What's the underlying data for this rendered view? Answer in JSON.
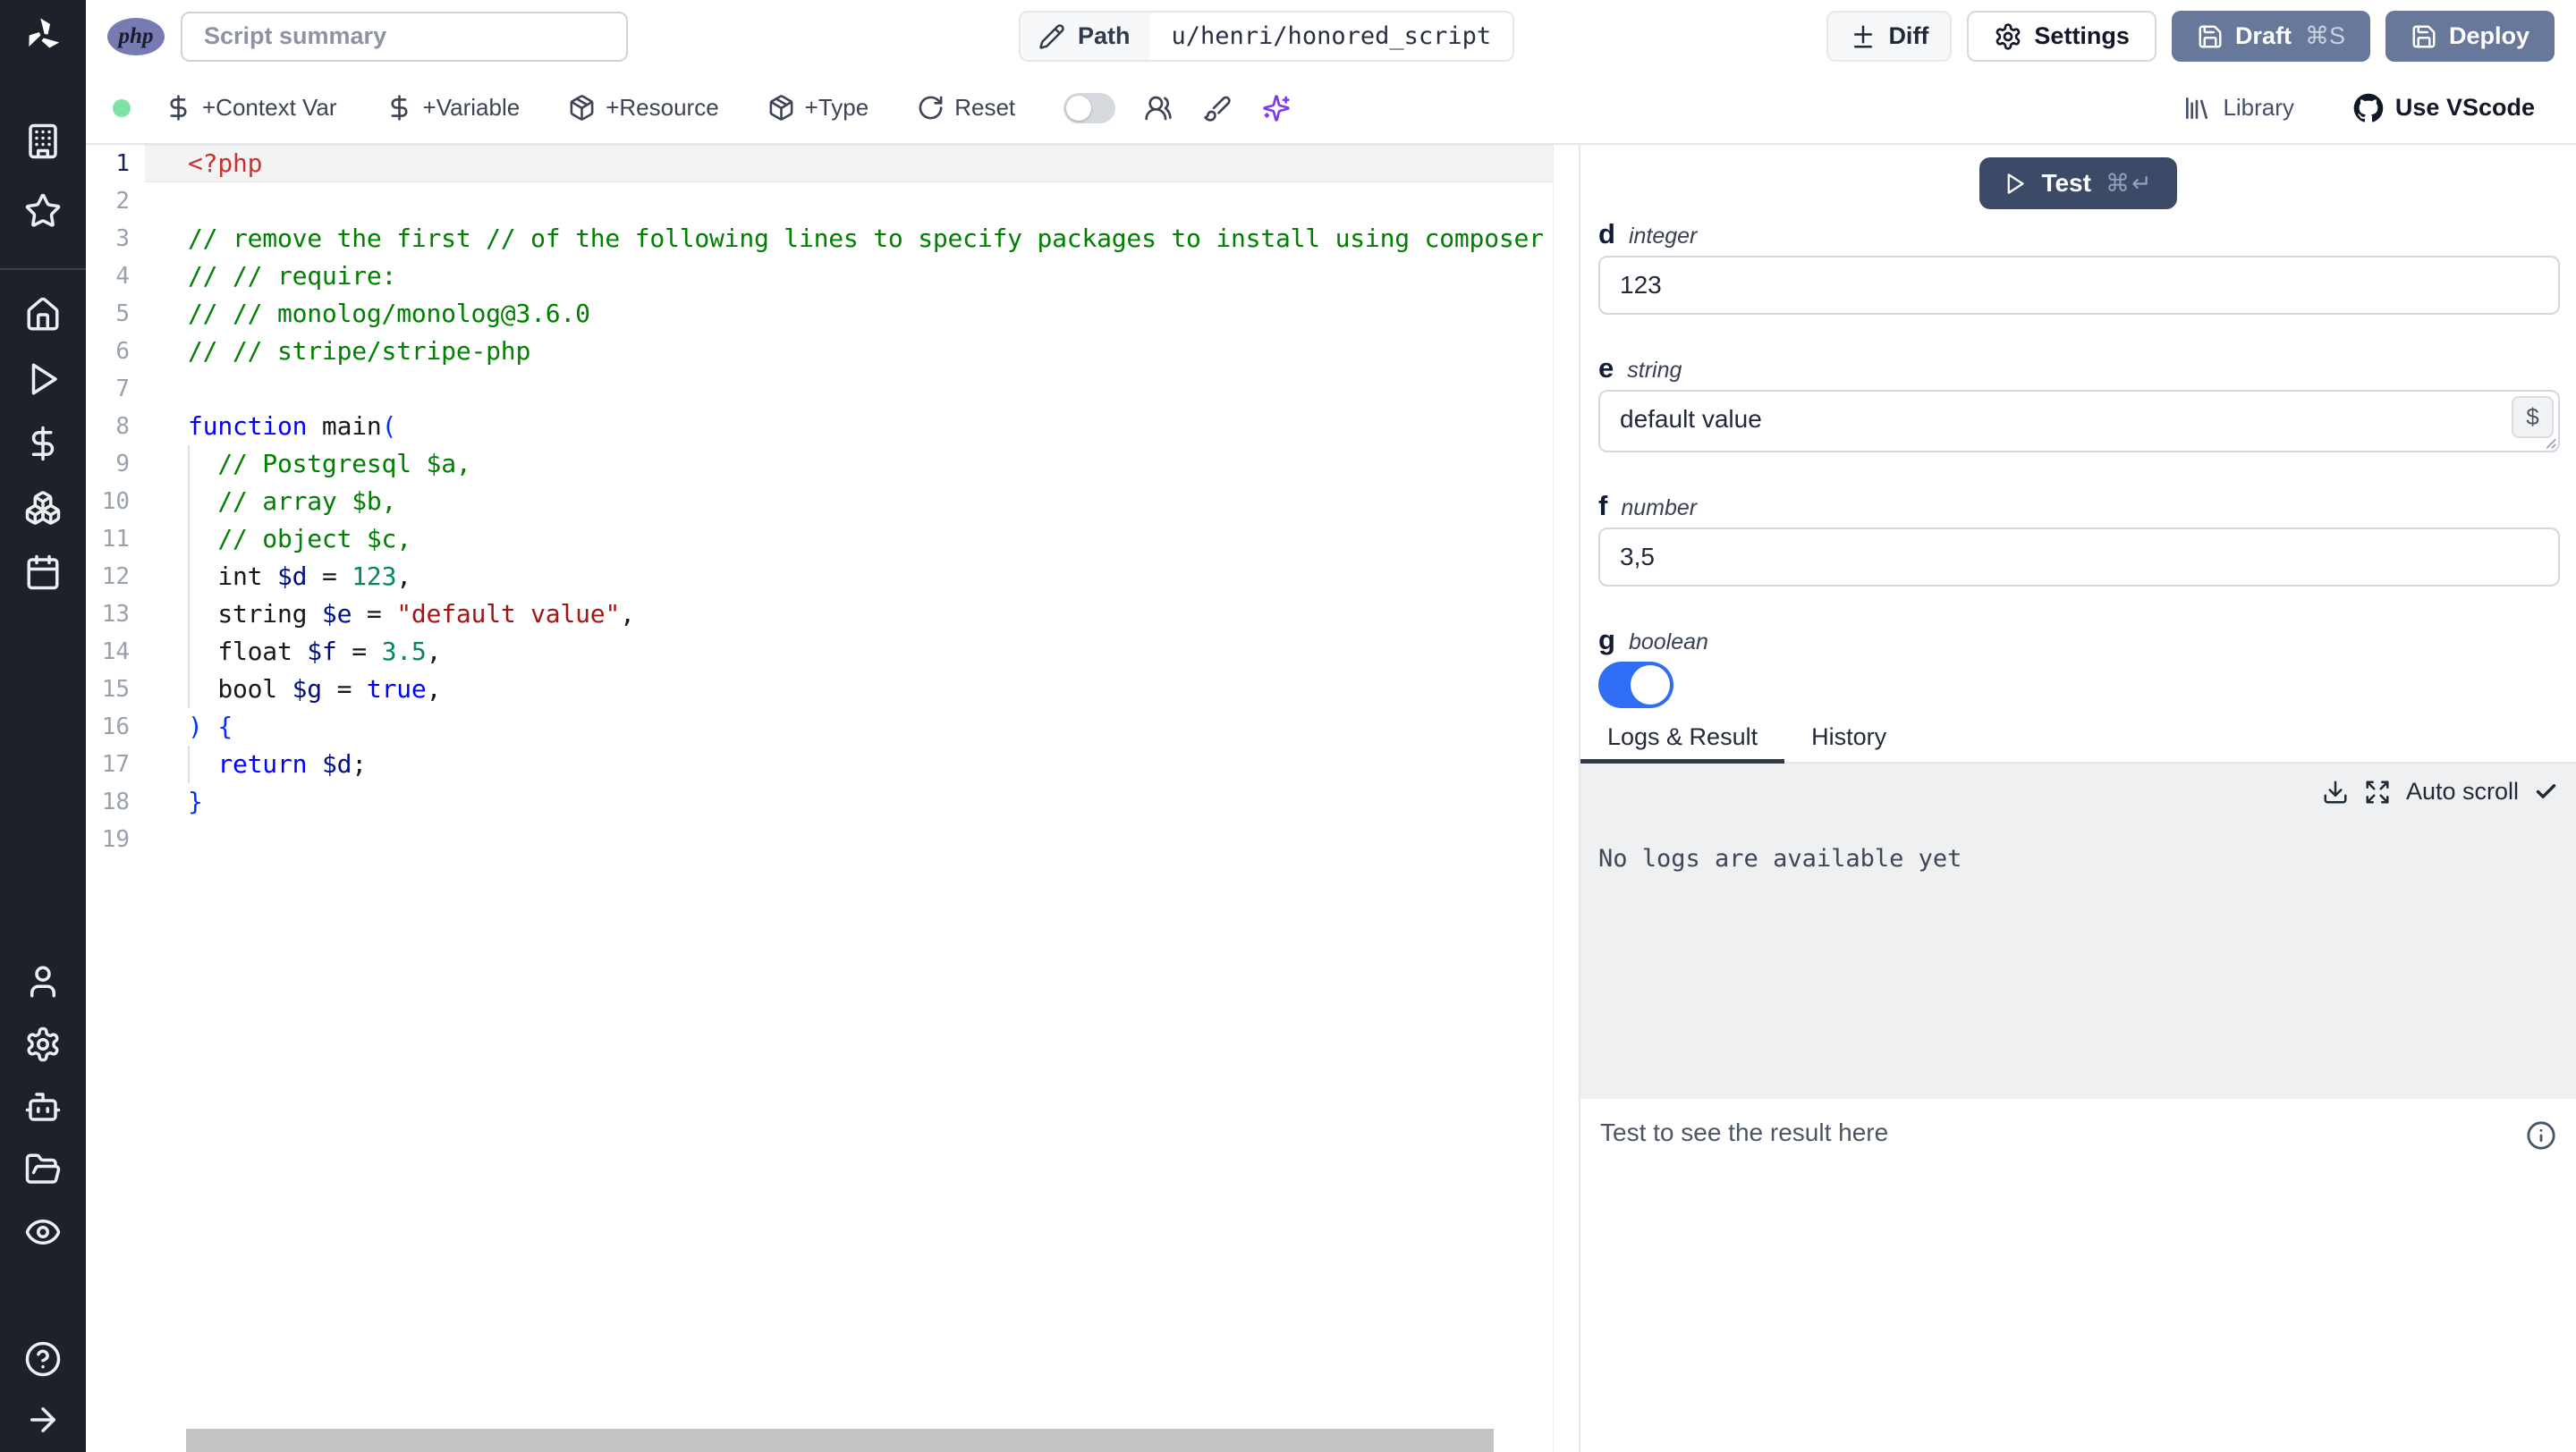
{
  "topbar": {
    "language_badge": "php",
    "summary_placeholder": "Script summary",
    "path": {
      "label": "Path",
      "value": "u/henri/honored_script"
    },
    "buttons": {
      "diff": "Diff",
      "settings": "Settings",
      "draft": "Draft",
      "draft_shortcut": "⌘S",
      "deploy": "Deploy"
    }
  },
  "toolbar": {
    "status_dot_color": "#7fe3a8",
    "items": [
      {
        "icon": "dollar-icon",
        "label": "+Context Var"
      },
      {
        "icon": "dollar-icon",
        "label": "+Variable"
      },
      {
        "icon": "package-icon",
        "label": "+Resource"
      },
      {
        "icon": "package-icon",
        "label": "+Type"
      },
      {
        "icon": "reset-icon",
        "label": "Reset"
      }
    ],
    "diff_mode_toggle_on": false,
    "icon_buttons": [
      "users-icon",
      "paintbrush-icon",
      "sparkles-icon"
    ],
    "right": [
      {
        "icon": "library-icon",
        "label": "Library",
        "strong": false
      },
      {
        "icon": "github-icon",
        "label": "Use VScode",
        "strong": true
      }
    ]
  },
  "sidebar": {
    "groups": {
      "top": [
        "building-icon",
        "star-icon"
      ],
      "main": [
        "home-icon",
        "play-icon",
        "dollar-icon",
        "boxes-icon",
        "calendar-icon"
      ],
      "account": [
        "user-icon",
        "gear-icon",
        "bot-icon",
        "folder-open-icon",
        "eye-icon"
      ],
      "footer": [
        "help-icon",
        "arrow-right-icon"
      ]
    }
  },
  "editor": {
    "language": "php",
    "current_line": 1,
    "lines": [
      {
        "n": 1,
        "guide": false,
        "tokens": [
          [
            "php-tag",
            "<?php"
          ]
        ]
      },
      {
        "n": 2,
        "guide": false,
        "tokens": []
      },
      {
        "n": 3,
        "guide": false,
        "tokens": [
          [
            "comment",
            "// remove the first // of the following lines to specify packages to install using composer"
          ]
        ]
      },
      {
        "n": 4,
        "guide": false,
        "tokens": [
          [
            "comment",
            "// // require:"
          ]
        ]
      },
      {
        "n": 5,
        "guide": false,
        "tokens": [
          [
            "comment",
            "// // monolog/monolog@3.6.0"
          ]
        ]
      },
      {
        "n": 6,
        "guide": false,
        "tokens": [
          [
            "comment",
            "// // stripe/stripe-php"
          ]
        ]
      },
      {
        "n": 7,
        "guide": false,
        "tokens": []
      },
      {
        "n": 8,
        "guide": false,
        "tokens": [
          [
            "keyword",
            "function"
          ],
          [
            "plain",
            " main"
          ],
          [
            "bracket",
            "("
          ]
        ]
      },
      {
        "n": 9,
        "guide": true,
        "tokens": [
          [
            "plain",
            "  "
          ],
          [
            "comment",
            "// Postgresql $a,"
          ]
        ]
      },
      {
        "n": 10,
        "guide": true,
        "tokens": [
          [
            "plain",
            "  "
          ],
          [
            "comment",
            "// array $b,"
          ]
        ]
      },
      {
        "n": 11,
        "guide": true,
        "tokens": [
          [
            "plain",
            "  "
          ],
          [
            "comment",
            "// object $c,"
          ]
        ]
      },
      {
        "n": 12,
        "guide": true,
        "tokens": [
          [
            "plain",
            "  int "
          ],
          [
            "variable",
            "$d"
          ],
          [
            "plain",
            " = "
          ],
          [
            "number",
            "123"
          ],
          [
            "plain",
            ","
          ]
        ]
      },
      {
        "n": 13,
        "guide": true,
        "tokens": [
          [
            "plain",
            "  string "
          ],
          [
            "variable",
            "$e"
          ],
          [
            "plain",
            " = "
          ],
          [
            "string",
            "\"default value\""
          ],
          [
            "plain",
            ","
          ]
        ]
      },
      {
        "n": 14,
        "guide": true,
        "tokens": [
          [
            "plain",
            "  float "
          ],
          [
            "variable",
            "$f"
          ],
          [
            "plain",
            " = "
          ],
          [
            "number",
            "3.5"
          ],
          [
            "plain",
            ","
          ]
        ]
      },
      {
        "n": 15,
        "guide": true,
        "tokens": [
          [
            "plain",
            "  bool "
          ],
          [
            "variable",
            "$g"
          ],
          [
            "plain",
            " = "
          ],
          [
            "keyword",
            "true"
          ],
          [
            "plain",
            ","
          ]
        ]
      },
      {
        "n": 16,
        "guide": false,
        "tokens": [
          [
            "bracket",
            ") {"
          ]
        ]
      },
      {
        "n": 17,
        "guide": true,
        "tokens": [
          [
            "plain",
            "  "
          ],
          [
            "keyword",
            "return"
          ],
          [
            "plain",
            " "
          ],
          [
            "variable",
            "$d"
          ],
          [
            "plain",
            ";"
          ]
        ]
      },
      {
        "n": 18,
        "guide": false,
        "tokens": [
          [
            "bracket",
            "}"
          ]
        ]
      },
      {
        "n": 19,
        "guide": false,
        "tokens": []
      }
    ]
  },
  "run_panel": {
    "test_button": {
      "label": "Test",
      "shortcut": "⌘↵"
    },
    "fields": [
      {
        "name": "d",
        "type": "integer",
        "control": "input",
        "value": "123"
      },
      {
        "name": "e",
        "type": "string",
        "control": "textarea",
        "value": "default value",
        "dollar_button": "$"
      },
      {
        "name": "f",
        "type": "number",
        "control": "input",
        "value": "3,5"
      },
      {
        "name": "g",
        "type": "boolean",
        "control": "toggle",
        "value": true
      }
    ],
    "tabs": [
      {
        "label": "Logs & Result",
        "active": true
      },
      {
        "label": "History",
        "active": false
      }
    ],
    "logs": {
      "auto_scroll_label": "Auto scroll",
      "empty_message": "No logs are available yet"
    },
    "result_placeholder": "Test to see the result here"
  },
  "colors": {
    "sidebar_bg": "#1e212a",
    "slate_button": "#68789a",
    "test_button": "#3c4a68",
    "toggle_on_blue": "#2f6df4",
    "status_green": "#7fe3a8",
    "ai_purple": "#7c3aed"
  }
}
